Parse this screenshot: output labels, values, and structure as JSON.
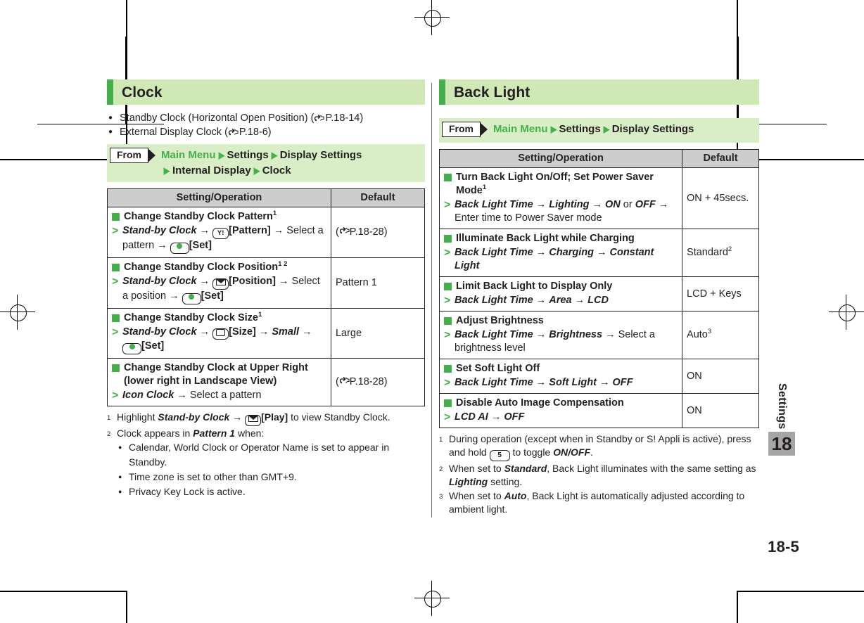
{
  "page": {
    "number": "18-5",
    "side_tab": {
      "label": "Settings",
      "chapter": "18"
    }
  },
  "colors": {
    "accent_green": "#43b049",
    "header_band": "#cfe8b5",
    "nav_band": "#d9eec6",
    "table_header": "#cdcdcd",
    "tab_grey": "#a6a6a6"
  },
  "left_column": {
    "section_title": "Clock",
    "bullets": [
      {
        "text": "Standby Clock (Horizontal Open Position) (",
        "ref": "P.18-14",
        "suffix": ")"
      },
      {
        "text": "External Display Clock (",
        "ref": "P.18-6",
        "suffix": ")"
      }
    ],
    "from": {
      "button_label": "From",
      "path_line1": [
        "Main Menu",
        "Settings",
        "Display Settings"
      ],
      "path_line2": [
        "Internal Display",
        "Clock"
      ]
    },
    "table": {
      "headers": [
        "Setting/Operation",
        "Default"
      ],
      "rows": [
        {
          "title": "Change Standby Clock Pattern",
          "title_sup": "1",
          "steps_html": "<span class=\"bi\">Stand-by Clock</span> → <span class=\"key\">Y!</span><b>[Pattern]</b> → Select a pattern → <span class=\"key dot\"><i></i></span><b>[Set]</b>",
          "default": "( P.18-28)",
          "default_ref": "P.18-28",
          "default_is_ref": true
        },
        {
          "title": "Change Standby Clock Position",
          "title_sup": "1 2",
          "steps_html": "<span class=\"bi\">Stand-by Clock</span> → <span class=\"key env\"><i></i></span><b>[Position]</b> → Select a position → <span class=\"key dot\"><i></i></span><b>[Set]</b>",
          "default": "Pattern 1",
          "default_is_ref": false
        },
        {
          "title": "Change Standby Clock Size",
          "title_sup": "1",
          "steps_html": "<span class=\"bi\">Stand-by Clock</span> → <span class=\"key tv\"><i></i></span><b>[Size]</b> → <span class=\"bi\">Small</span> → <span class=\"key dot\"><i></i></span><b>[Set]</b>",
          "default": "Large",
          "default_is_ref": false
        },
        {
          "title": "Change Standby Clock at Upper Right (lower right in Landscape View)",
          "title_sup": "",
          "steps_html": "<span class=\"bi\">Icon Clock</span> → Select a pattern",
          "default": "( P.18-28)",
          "default_ref": "P.18-28",
          "default_is_ref": true
        }
      ]
    },
    "footnotes": [
      {
        "marker": "1",
        "html": "Highlight <span class=\"bi\">Stand-by Clock</span> → <span class=\"key env\"><i></i></span><b>[Play]</b> to view Standby Clock."
      },
      {
        "marker": "2",
        "html": "Clock appears in <span class=\"bi\">Pattern 1</span> when:",
        "sub_bullets": [
          "Calendar, World Clock or Operator Name is set to appear in Standby.",
          "Time zone is set to other than GMT+9.",
          "Privacy Key Lock is active."
        ]
      }
    ]
  },
  "right_column": {
    "section_title": "Back Light",
    "from": {
      "button_label": "From",
      "path_line1": [
        "Main Menu",
        "Settings",
        "Display Settings"
      ]
    },
    "table": {
      "headers": [
        "Setting/Operation",
        "Default"
      ],
      "rows": [
        {
          "title": "Turn Back Light On/Off; Set Power Saver Mode",
          "title_sup": "1",
          "steps_html": "<span class=\"bi\">Back Light Time</span> → <span class=\"bi\">Lighting</span> → <span class=\"bi\">ON</span> or <span class=\"bi\">OFF</span> → Enter time to Power Saver mode",
          "default": "ON + 45secs."
        },
        {
          "title": "Illuminate Back Light while Charging",
          "title_sup": "",
          "steps_html": "<span class=\"bi\">Back Light Time</span> → <span class=\"bi\">Charging</span> → <span class=\"bi\">Constant Light</span>",
          "default": "Standard",
          "default_sup": "2"
        },
        {
          "title": "Limit Back Light to Display Only",
          "title_sup": "",
          "steps_html": "<span class=\"bi\">Back Light Time</span> → <span class=\"bi\">Area</span> → <span class=\"bi\">LCD</span>",
          "default": "LCD + Keys"
        },
        {
          "title": "Adjust Brightness",
          "title_sup": "",
          "steps_html": "<span class=\"bi\">Back Light Time</span> → <span class=\"bi\">Brightness</span> → Select a brightness level",
          "default": "Auto",
          "default_sup": "3"
        },
        {
          "title": "Set Soft Light Off",
          "title_sup": "",
          "steps_html": "<span class=\"bi\">Back Light Time</span> → <span class=\"bi\">Soft Light</span> → <span class=\"bi\">OFF</span>",
          "default": "ON"
        },
        {
          "title": "Disable Auto Image Compensation",
          "title_sup": "",
          "steps_html": "<span class=\"bi\">LCD AI</span> → <span class=\"bi\">OFF</span>",
          "default": "ON"
        }
      ]
    },
    "footnotes": [
      {
        "marker": "1",
        "html": "During operation (except when in Standby or S! Appli is active), press and hold <span class=\"key num\">5</span> to toggle <span class=\"bi\">ON/OFF</span>."
      },
      {
        "marker": "2",
        "html": "When set to <span class=\"bi\">Standard</span>, Back Light illuminates with the same setting as <span class=\"bi\">Lighting</span> setting."
      },
      {
        "marker": "3",
        "html": "When set to <span class=\"bi\">Auto</span>, Back Light is automatically adjusted according to ambient light."
      }
    ]
  }
}
